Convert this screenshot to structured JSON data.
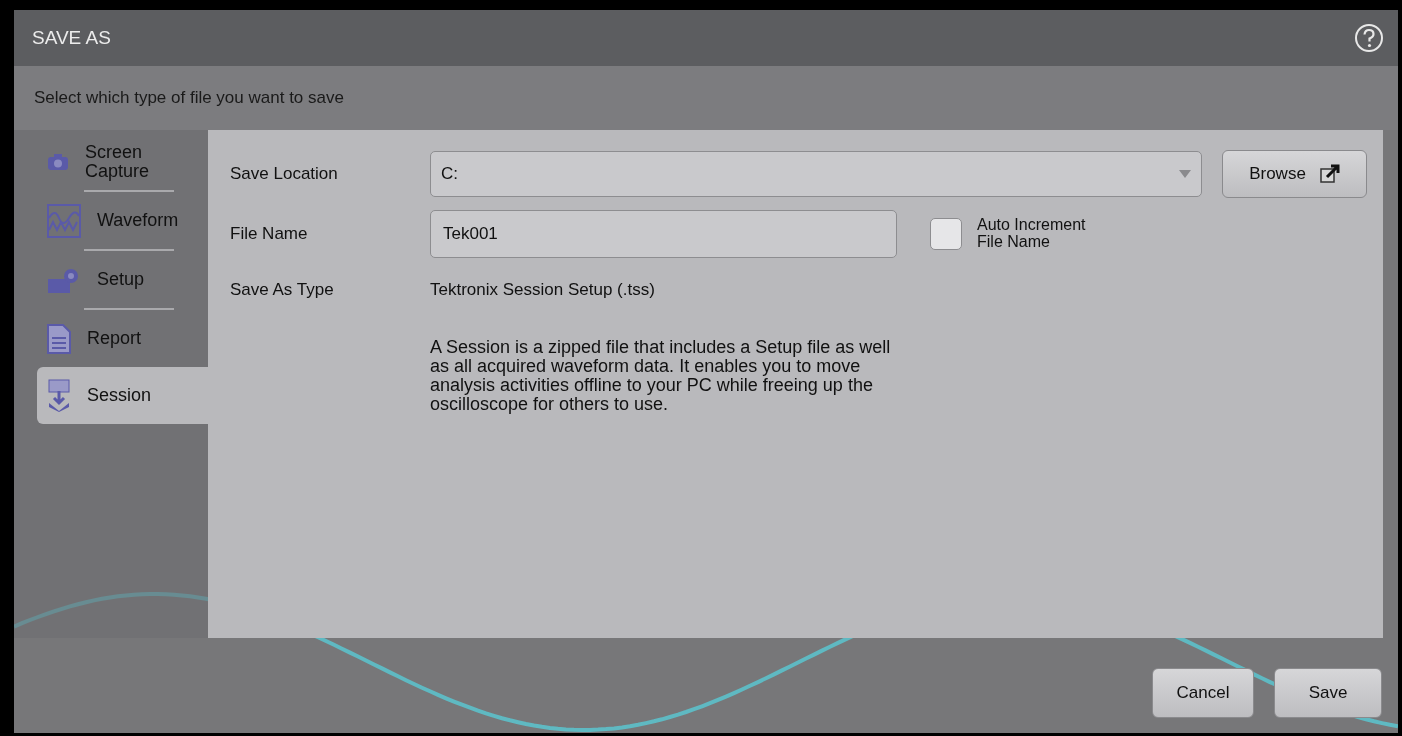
{
  "dialog": {
    "title": "SAVE AS",
    "subtitle": "Select which type of file you want to save"
  },
  "file_types": [
    {
      "label": "Screen Capture",
      "kind": "camera",
      "selected": false
    },
    {
      "label": "Waveform",
      "kind": "waveform",
      "selected": false
    },
    {
      "label": "Setup",
      "kind": "setup",
      "selected": false
    },
    {
      "label": "Report",
      "kind": "report",
      "selected": false
    },
    {
      "label": "Session",
      "kind": "session",
      "selected": true
    }
  ],
  "form": {
    "save_location": {
      "label": "Save Location",
      "value": "C:"
    },
    "browse_button": "Browse",
    "file_name": {
      "label": "File Name",
      "value": "Tek001"
    },
    "auto_increment": {
      "label": "Auto Increment File Name",
      "checked": false
    },
    "save_as_type": {
      "label": "Save As Type",
      "value": "Tektronix Session Setup (.tss)"
    },
    "description": "A Session is a zipped file that includes a Setup file as well as all acquired waveform data. It enables you to move analysis activities offline to your PC while freeing up the oscilloscope for others to use."
  },
  "buttons": [
    {
      "label": "Cancel"
    },
    {
      "label": "Save"
    }
  ]
}
